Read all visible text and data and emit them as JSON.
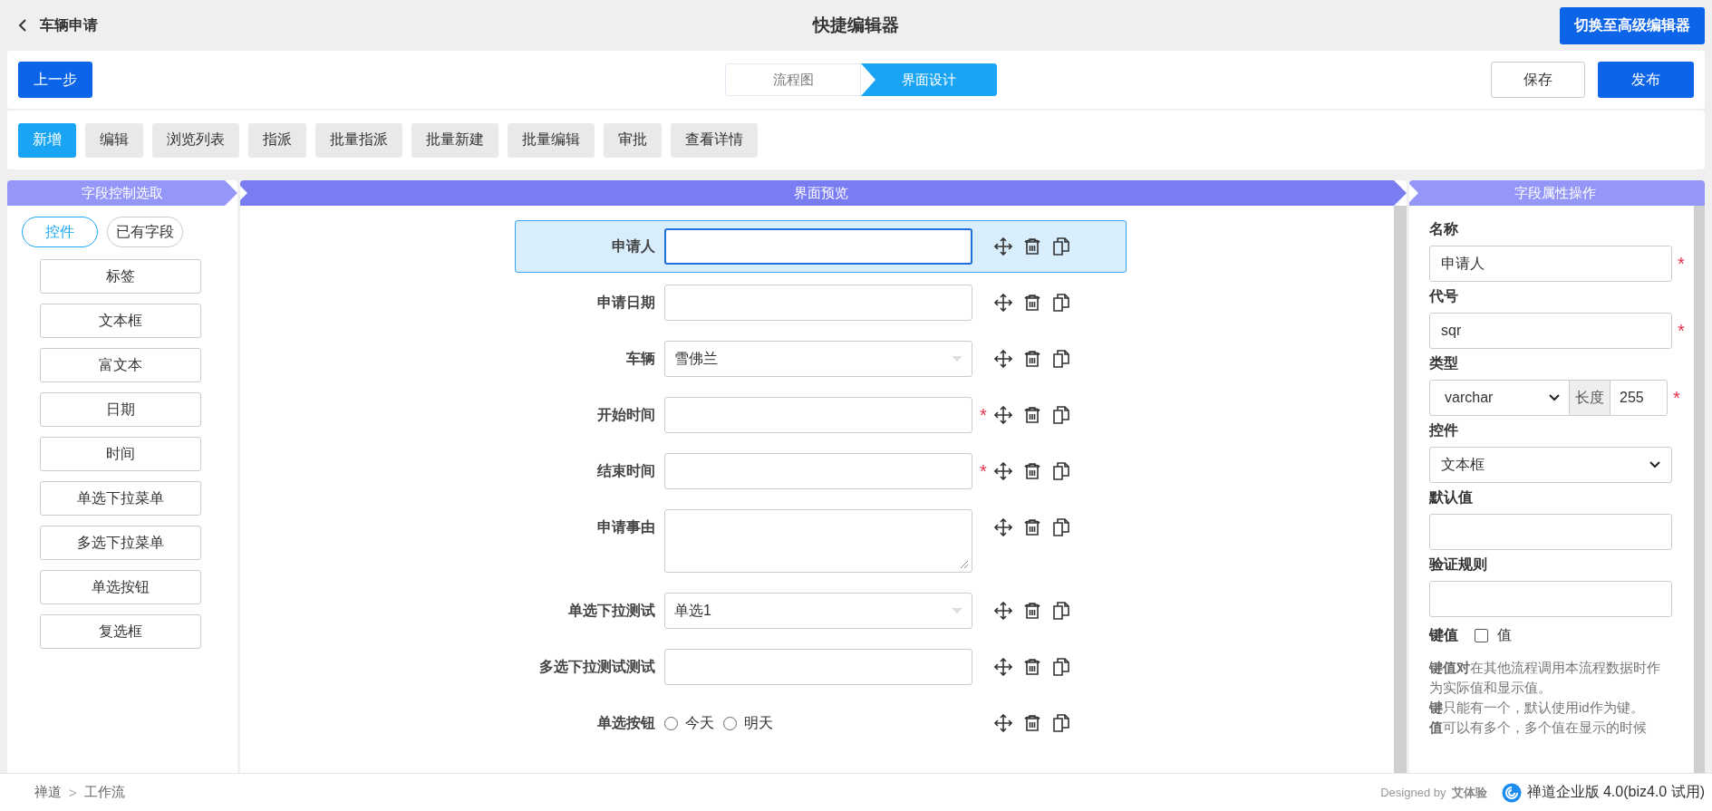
{
  "header": {
    "back_label": "车辆申请",
    "title": "快捷编辑器",
    "switch_button": "切换至高级编辑器"
  },
  "toolbar": {
    "prev_button": "上一步",
    "steps": [
      {
        "label": "流程图",
        "selected": false
      },
      {
        "label": "界面设计",
        "selected": true
      }
    ],
    "save_button": "保存",
    "publish_button": "发布"
  },
  "actions": [
    {
      "label": "新增",
      "selected": true
    },
    {
      "label": "编辑",
      "selected": false
    },
    {
      "label": "浏览列表",
      "selected": false
    },
    {
      "label": "指派",
      "selected": false
    },
    {
      "label": "批量指派",
      "selected": false
    },
    {
      "label": "批量新建",
      "selected": false
    },
    {
      "label": "批量编辑",
      "selected": false
    },
    {
      "label": "审批",
      "selected": false
    },
    {
      "label": "查看详情",
      "selected": false
    }
  ],
  "left_panel": {
    "title": "字段控制选取",
    "toggles": [
      {
        "label": "控件",
        "selected": true
      },
      {
        "label": "已有字段",
        "selected": false
      }
    ],
    "controls": [
      "标签",
      "文本框",
      "富文本",
      "日期",
      "时间",
      "单选下拉菜单",
      "多选下拉菜单",
      "单选按钮",
      "复选框"
    ]
  },
  "center_panel": {
    "title": "界面预览",
    "required_mark": "*",
    "fields": [
      {
        "label": "申请人",
        "kind": "input",
        "required": false,
        "selected": true
      },
      {
        "label": "申请日期",
        "kind": "input",
        "required": false,
        "selected": false
      },
      {
        "label": "车辆",
        "kind": "select",
        "value": "雪佛兰",
        "required": false,
        "selected": false
      },
      {
        "label": "开始时间",
        "kind": "input",
        "required": true,
        "selected": false
      },
      {
        "label": "结束时间",
        "kind": "input",
        "required": true,
        "selected": false
      },
      {
        "label": "申请事由",
        "kind": "textarea",
        "required": false,
        "selected": false
      },
      {
        "label": "单选下拉测试",
        "kind": "select",
        "value": "单选1",
        "required": false,
        "selected": false
      },
      {
        "label": "多选下拉测试测试",
        "kind": "input",
        "required": false,
        "selected": false
      },
      {
        "label": "单选按钮",
        "kind": "radio",
        "options": [
          {
            "label": "今天",
            "checked": false
          },
          {
            "label": "明天",
            "checked": false
          }
        ],
        "required": false,
        "selected": false
      }
    ]
  },
  "right_panel": {
    "title": "字段属性操作",
    "required_mark": "*",
    "name_label": "名称",
    "name_value": "申请人",
    "code_label": "代号",
    "code_value": "sqr",
    "type_label": "类型",
    "type_value": "varchar",
    "length_label": "长度",
    "length_value": "255",
    "control_label": "控件",
    "control_value": "文本框",
    "default_label": "默认值",
    "rule_label": "验证规则",
    "key_label": "键值",
    "key_checkbox": {
      "label": "值",
      "checked": false
    },
    "help": [
      "**键值对**在其他流程调用本流程数据时作为实际值和显示值。",
      "**键**只能有一个，默认使用id作为键。",
      "**值**可以有多个，多个值在显示的时候"
    ]
  },
  "footer": {
    "breadcrumb": [
      "禅道",
      "工作流"
    ],
    "separator": ">",
    "designed_by": "Designed by",
    "designer": "艾体验",
    "version": "禅道企业版 4.0(biz4.0 试用)"
  }
}
